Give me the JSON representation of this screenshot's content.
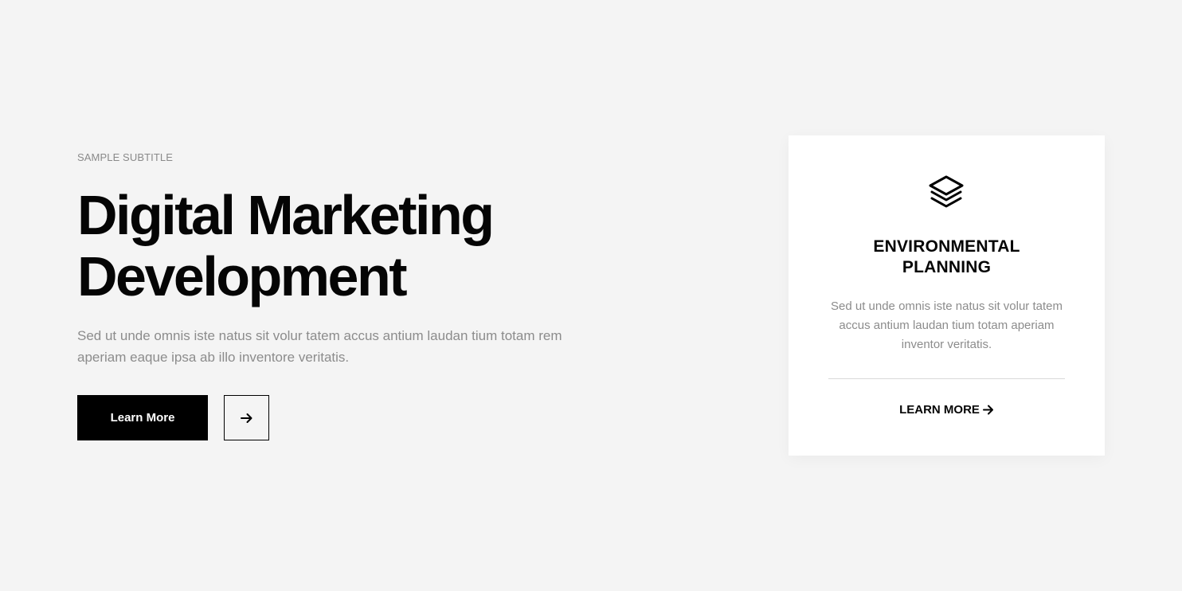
{
  "hero": {
    "subtitle": "SAMPLE SUBTITLE",
    "headline_line1": "Digital Marketing",
    "headline_line2": "Development",
    "lead": "Sed ut unde omnis iste natus sit volur tatem accus antium laudan tium totam rem aperiam eaque ipsa ab illo inventore veritatis.",
    "primary_button_label": "Learn More",
    "arrow_button_icon": "arrow-right-icon"
  },
  "card": {
    "icon": "layers-icon",
    "title_line1": "ENVIRONMENTAL",
    "title_line2": "PLANNING",
    "text": "Sed ut unde omnis iste natus sit volur tatem accus antium laudan tium totam aperiam inventor veritatis.",
    "link_label": "LEARN MORE",
    "link_icon": "arrow-right-icon"
  },
  "colors": {
    "background": "#f4f4f4",
    "card_background": "#ffffff",
    "primary": "#000000",
    "muted_text": "#8c8c8c"
  }
}
